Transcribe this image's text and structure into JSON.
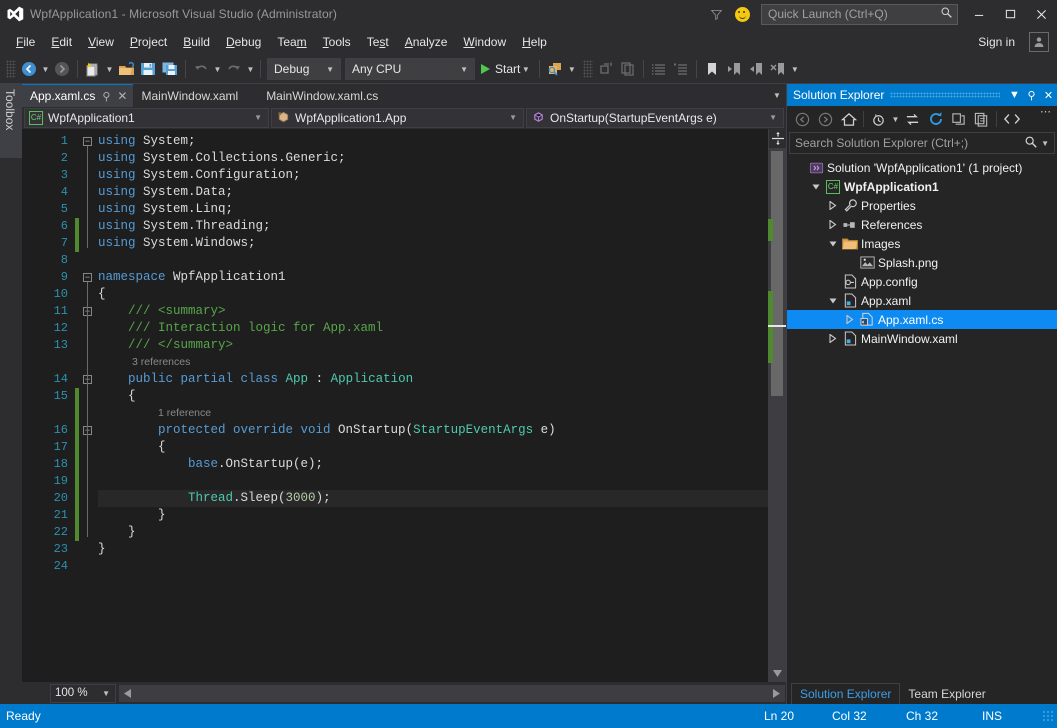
{
  "titlebar": {
    "app_title": "WpfApplication1 - Microsoft Visual Studio (Administrator)",
    "logo_icon": "visual-studio-logo-icon",
    "filter_icon": "funnel-icon",
    "feedback_icon": "smiley-feedback-icon",
    "quick_launch_placeholder": "Quick Launch (Ctrl+Q)",
    "quick_launch_value": "",
    "search_icon": "magnifier-icon",
    "minimize_label": "–",
    "maximize_label": "❐",
    "close_label": "✕"
  },
  "menubar": {
    "items": [
      {
        "label": "File",
        "accel": "F"
      },
      {
        "label": "Edit",
        "accel": "E"
      },
      {
        "label": "View",
        "accel": "V"
      },
      {
        "label": "Project",
        "accel": "P"
      },
      {
        "label": "Build",
        "accel": "B"
      },
      {
        "label": "Debug",
        "accel": "D"
      },
      {
        "label": "Team",
        "accel": "m"
      },
      {
        "label": "Tools",
        "accel": "T"
      },
      {
        "label": "Test",
        "accel": "s"
      },
      {
        "label": "Analyze",
        "accel": "A"
      },
      {
        "label": "Window",
        "accel": "W"
      },
      {
        "label": "Help",
        "accel": "H"
      }
    ],
    "signin_label": "Sign in",
    "account_icon": "user-account-icon"
  },
  "toolbar": {
    "nav_back_icon": "navigate-backward-icon",
    "nav_forward_icon": "navigate-forward-icon",
    "new_project_icon": "new-project-icon",
    "open_file_icon": "open-file-icon",
    "save_icon": "save-icon",
    "save_all_icon": "save-all-icon",
    "undo_icon": "undo-icon",
    "redo_icon": "redo-icon",
    "config_value": "Debug",
    "platform_value": "Any CPU",
    "start_label": "Start",
    "start_icon": "play-icon",
    "attach_icon": "attach-to-process-icon",
    "find_icon": "find-in-files-icon",
    "step_out_icon": "step-out-icon",
    "copy_icon": "copy-icon",
    "indent_icon": "increase-indent-icon",
    "outdent_icon": "decrease-indent-icon",
    "comment_icon": "comment-icon",
    "uncomment_icon": "uncomment-icon",
    "bookmark_icon": "bookmark-icon",
    "prev_bookmark_icon": "previous-bookmark-icon",
    "next_bookmark_icon": "next-bookmark-icon",
    "clear_bookmark_icon": "clear-bookmarks-icon",
    "overflow_icon": "toolbar-overflow-icon"
  },
  "toolbox": {
    "label": "Toolbox"
  },
  "editor": {
    "tabs": [
      {
        "label": "App.xaml.cs",
        "active": true,
        "pin_icon": "pin-icon",
        "close_icon": "close-icon"
      },
      {
        "label": "MainWindow.xaml",
        "active": false
      },
      {
        "label": "MainWindow.xaml.cs",
        "active": false
      }
    ],
    "tab_overflow_icon": "tab-list-icon",
    "navbar": {
      "project_value": "WpfApplication1",
      "project_icon": "csharp-project-icon",
      "type_value": "WpfApplication1.App",
      "type_icon": "class-icon",
      "member_value": "OnStartup(StartupEventArgs e)",
      "member_icon": "method-icon"
    },
    "split_icon": "split-view-icon",
    "zoom_value": "100 %",
    "lines": [
      {
        "n": 1,
        "fold": "minus",
        "change": false,
        "current": false,
        "tokens": [
          {
            "t": "using",
            "c": "kw"
          },
          {
            "t": " System;",
            "c": "id"
          }
        ]
      },
      {
        "n": 2,
        "fold": "",
        "change": false,
        "current": false,
        "tokens": [
          {
            "t": "using",
            "c": "kw"
          },
          {
            "t": " System.Collections.Generic;",
            "c": "id"
          }
        ]
      },
      {
        "n": 3,
        "fold": "",
        "change": false,
        "current": false,
        "tokens": [
          {
            "t": "using",
            "c": "kw"
          },
          {
            "t": " System.Configuration;",
            "c": "id"
          }
        ]
      },
      {
        "n": 4,
        "fold": "",
        "change": false,
        "current": false,
        "tokens": [
          {
            "t": "using",
            "c": "kw"
          },
          {
            "t": " System.Data;",
            "c": "id"
          }
        ]
      },
      {
        "n": 5,
        "fold": "",
        "change": false,
        "current": false,
        "tokens": [
          {
            "t": "using",
            "c": "kw"
          },
          {
            "t": " System.Linq;",
            "c": "id"
          }
        ]
      },
      {
        "n": 6,
        "fold": "",
        "change": true,
        "current": false,
        "tokens": [
          {
            "t": "using",
            "c": "kw"
          },
          {
            "t": " System.Threading;",
            "c": "id"
          }
        ]
      },
      {
        "n": 7,
        "fold": "",
        "change": true,
        "current": false,
        "tokens": [
          {
            "t": "using",
            "c": "kw"
          },
          {
            "t": " System.Windows;",
            "c": "id"
          }
        ]
      },
      {
        "n": 8,
        "fold": "",
        "change": false,
        "current": false,
        "tokens": []
      },
      {
        "n": 9,
        "fold": "minus",
        "change": false,
        "current": false,
        "tokens": [
          {
            "t": "namespace",
            "c": "kw"
          },
          {
            "t": " WpfApplication1",
            "c": "id"
          }
        ]
      },
      {
        "n": 10,
        "fold": "",
        "change": false,
        "current": false,
        "tokens": [
          {
            "t": "{",
            "c": "id"
          }
        ]
      },
      {
        "n": 11,
        "fold": "minus",
        "change": false,
        "current": false,
        "tokens": [
          {
            "t": "    /// <summary>",
            "c": "cmt"
          }
        ]
      },
      {
        "n": 12,
        "fold": "",
        "change": false,
        "current": false,
        "tokens": [
          {
            "t": "    /// Interaction logic for App.xaml",
            "c": "cmt"
          }
        ]
      },
      {
        "n": 13,
        "fold": "",
        "change": false,
        "current": false,
        "tokens": [
          {
            "t": "    /// </summary>",
            "c": "cmt"
          }
        ]
      },
      {
        "n": 14,
        "fold": "minus",
        "change": false,
        "current": false,
        "lens": "3 references",
        "tokens": [
          {
            "t": "    ",
            "c": "id"
          },
          {
            "t": "public partial class",
            "c": "kw"
          },
          {
            "t": " App ",
            "c": "typ"
          },
          {
            "t": ":",
            "c": "id"
          },
          {
            "t": " Application",
            "c": "typ"
          }
        ]
      },
      {
        "n": 15,
        "fold": "",
        "change": true,
        "current": false,
        "tokens": [
          {
            "t": "    {",
            "c": "id"
          }
        ]
      },
      {
        "n": 16,
        "fold": "minus",
        "change": true,
        "current": false,
        "lens": "1 reference",
        "tokens": [
          {
            "t": "        ",
            "c": "id"
          },
          {
            "t": "protected override void",
            "c": "kw"
          },
          {
            "t": " OnStartup",
            "c": "id"
          },
          {
            "t": "(",
            "c": "id"
          },
          {
            "t": "StartupEventArgs",
            "c": "typ"
          },
          {
            "t": " e)",
            "c": "id"
          }
        ]
      },
      {
        "n": 17,
        "fold": "",
        "change": true,
        "current": false,
        "tokens": [
          {
            "t": "        {",
            "c": "id"
          }
        ]
      },
      {
        "n": 18,
        "fold": "",
        "change": true,
        "current": false,
        "tokens": [
          {
            "t": "            ",
            "c": "id"
          },
          {
            "t": "base",
            "c": "kw"
          },
          {
            "t": ".OnStartup(e);",
            "c": "id"
          }
        ]
      },
      {
        "n": 19,
        "fold": "",
        "change": true,
        "current": false,
        "tokens": []
      },
      {
        "n": 20,
        "fold": "",
        "change": true,
        "current": true,
        "tokens": [
          {
            "t": "            ",
            "c": "id"
          },
          {
            "t": "Thread",
            "c": "typ"
          },
          {
            "t": ".Sleep(",
            "c": "id"
          },
          {
            "t": "3000",
            "c": "num"
          },
          {
            "t": ");",
            "c": "id"
          }
        ]
      },
      {
        "n": 21,
        "fold": "",
        "change": true,
        "current": false,
        "tokens": [
          {
            "t": "        }",
            "c": "id"
          }
        ]
      },
      {
        "n": 22,
        "fold": "",
        "change": true,
        "current": false,
        "tokens": [
          {
            "t": "    }",
            "c": "id"
          }
        ]
      },
      {
        "n": 23,
        "fold": "",
        "change": false,
        "current": false,
        "tokens": [
          {
            "t": "}",
            "c": "id"
          }
        ]
      },
      {
        "n": 24,
        "fold": "",
        "change": false,
        "current": false,
        "tokens": []
      }
    ]
  },
  "solution_explorer": {
    "title": "Solution Explorer",
    "dropdown_icon": "chevron-down-icon",
    "pin_icon": "pin-icon",
    "close_icon": "close-icon",
    "toolbar": {
      "back_icon": "back-icon",
      "forward_icon": "forward-icon",
      "home_icon": "home-icon",
      "pending_changes_icon": "pending-changes-icon",
      "sync_icon": "sync-with-active-document-icon",
      "refresh_icon": "refresh-icon",
      "collapse_all_icon": "collapse-all-icon",
      "show_all_files_icon": "show-all-files-icon",
      "view_code_icon": "view-code-icon",
      "overflow_icon": "toolbar-overflow-icon"
    },
    "search_placeholder": "Search Solution Explorer (Ctrl+;)",
    "search_value": "",
    "search_icon": "magnifier-icon",
    "search_dropdown_icon": "chevron-down-icon",
    "tree": [
      {
        "label": "Solution 'WpfApplication1' (1 project)",
        "indent": 0,
        "expander": "",
        "icon": "solution-icon",
        "bold": false,
        "selected": false
      },
      {
        "label": "WpfApplication1",
        "indent": 1,
        "expander": "open",
        "icon": "csharp-project-icon",
        "bold": true,
        "selected": false
      },
      {
        "label": "Properties",
        "indent": 2,
        "expander": "closed",
        "icon": "properties-wrench-icon",
        "bold": false,
        "selected": false
      },
      {
        "label": "References",
        "indent": 2,
        "expander": "closed",
        "icon": "references-icon",
        "bold": false,
        "selected": false
      },
      {
        "label": "Images",
        "indent": 2,
        "expander": "open",
        "icon": "folder-icon",
        "bold": false,
        "selected": false
      },
      {
        "label": "Splash.png",
        "indent": 3,
        "expander": "",
        "icon": "image-file-icon",
        "bold": false,
        "selected": false
      },
      {
        "label": "App.config",
        "indent": 2,
        "expander": "",
        "icon": "config-file-icon",
        "bold": false,
        "selected": false
      },
      {
        "label": "App.xaml",
        "indent": 2,
        "expander": "open",
        "icon": "xaml-file-icon",
        "bold": false,
        "selected": false
      },
      {
        "label": "App.xaml.cs",
        "indent": 3,
        "expander": "closed",
        "icon": "csharp-codebehind-icon",
        "bold": false,
        "selected": true
      },
      {
        "label": "MainWindow.xaml",
        "indent": 2,
        "expander": "closed",
        "icon": "xaml-file-icon",
        "bold": false,
        "selected": false
      }
    ],
    "tabs": [
      {
        "label": "Solution Explorer",
        "active": true
      },
      {
        "label": "Team Explorer",
        "active": false
      }
    ]
  },
  "statusbar": {
    "ready": "Ready",
    "line": "Ln 20",
    "column": "Col 32",
    "character": "Ch 32",
    "insert_mode": "INS"
  },
  "colors": {
    "accent": "#007acc",
    "selection": "#0d8bf2",
    "chrome": "#2d2d30",
    "panel": "#252526",
    "editor_bg": "#1e1e1e",
    "changebar_green": "#4f8a2e",
    "keyword_blue": "#569cd6",
    "type_teal": "#4ec9b0",
    "comment_green": "#57a64a",
    "number_green": "#b5cea8",
    "linenum_blue": "#2b91af"
  }
}
